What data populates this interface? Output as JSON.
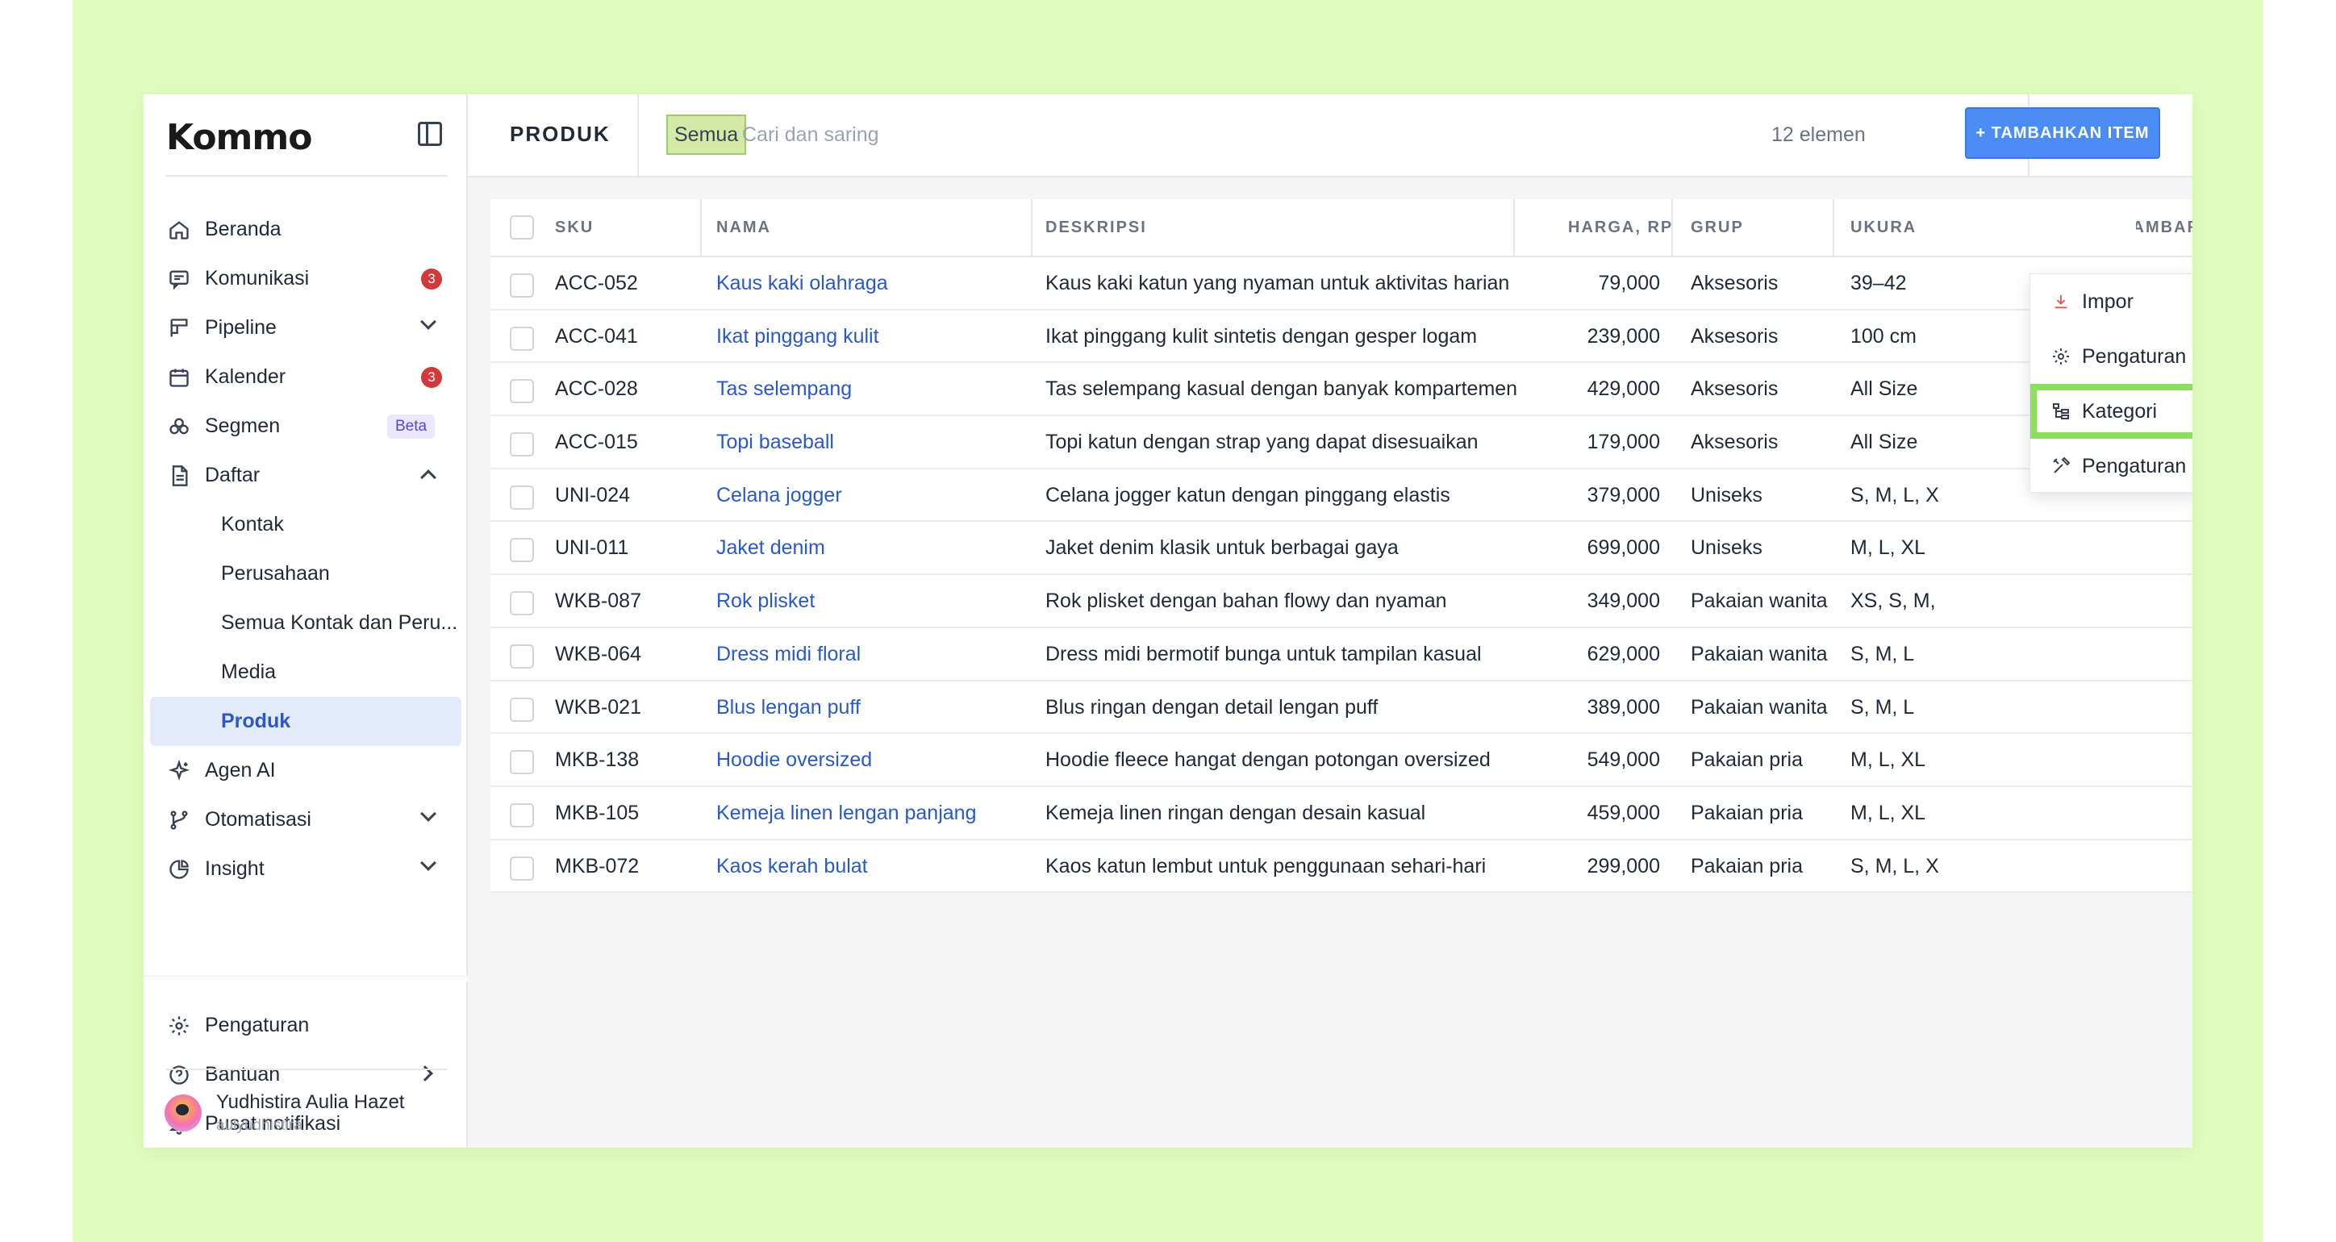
{
  "app": {
    "logo": "Kommo"
  },
  "sidebar": {
    "items": [
      {
        "label": "Beranda",
        "icon": "home-icon"
      },
      {
        "label": "Komunikasi",
        "icon": "chat-icon",
        "badge": "3"
      },
      {
        "label": "Pipeline",
        "icon": "pipeline-icon"
      },
      {
        "label": "Kalender",
        "icon": "calendar-icon",
        "badge": "3"
      },
      {
        "label": "Segmen",
        "icon": "segment-icon",
        "tag": "Beta"
      },
      {
        "label": "Daftar",
        "icon": "list-icon"
      },
      {
        "label": "Kontak"
      },
      {
        "label": "Perusahaan"
      },
      {
        "label": "Semua Kontak dan Peru..."
      },
      {
        "label": "Media"
      },
      {
        "label": "Produk"
      },
      {
        "label": "Agen AI",
        "icon": "sparkle-icon"
      },
      {
        "label": "Otomatisasi",
        "icon": "automation-icon"
      },
      {
        "label": "Insight",
        "icon": "chart-pie-icon"
      }
    ],
    "bottom": [
      {
        "label": "Pengaturan",
        "icon": "gear-icon"
      },
      {
        "label": "Bantuan",
        "icon": "help-icon"
      },
      {
        "label": "Pusat notifikasi",
        "icon": "bell-icon"
      }
    ],
    "user": {
      "name": "Yudhistira Aulia Hazet",
      "login": "aulyudhistira"
    }
  },
  "header": {
    "title": "PRODUK",
    "filter_chip": "Semua",
    "search_placeholder": "Cari dan saring",
    "count": "12 elemen",
    "more": "···",
    "add_button": "+ TAMBAHKAN ITEM"
  },
  "table": {
    "columns": [
      "SKU",
      "NAMA",
      "DESKRIPSI",
      "HARGA, RP",
      "GRUP",
      "UKURA",
      "GAMBAR"
    ],
    "rows": [
      {
        "sku": "ACC-052",
        "nama": "Kaus kaki olahraga",
        "desk": "Kaus kaki katun yang nyaman untuk aktivitas harian",
        "harga": "79,000",
        "grup": "Aksesoris",
        "ukuran": "39–42"
      },
      {
        "sku": "ACC-041",
        "nama": "Ikat pinggang kulit",
        "desk": "Ikat pinggang kulit sintetis dengan gesper logam",
        "harga": "239,000",
        "grup": "Aksesoris",
        "ukuran": "100 cm"
      },
      {
        "sku": "ACC-028",
        "nama": "Tas selempang",
        "desk": "Tas selempang kasual dengan banyak kompartemen",
        "harga": "429,000",
        "grup": "Aksesoris",
        "ukuran": "All Size"
      },
      {
        "sku": "ACC-015",
        "nama": "Topi baseball",
        "desk": "Topi katun dengan strap yang dapat disesuaikan",
        "harga": "179,000",
        "grup": "Aksesoris",
        "ukuran": "All Size"
      },
      {
        "sku": "UNI-024",
        "nama": "Celana jogger",
        "desk": "Celana jogger katun dengan pinggang elastis",
        "harga": "379,000",
        "grup": "Uniseks",
        "ukuran": "S, M, L, XL"
      },
      {
        "sku": "UNI-011",
        "nama": "Jaket denim",
        "desk": "Jaket denim klasik untuk berbagai gaya",
        "harga": "699,000",
        "grup": "Uniseks",
        "ukuran": "M, L, XL"
      },
      {
        "sku": "WKB-087",
        "nama": "Rok plisket",
        "desk": "Rok plisket dengan bahan flowy dan nyaman",
        "harga": "349,000",
        "grup": "Pakaian wanita",
        "ukuran": "XS, S, M, L"
      },
      {
        "sku": "WKB-064",
        "nama": "Dress midi floral",
        "desk": "Dress midi bermotif bunga untuk tampilan kasual",
        "harga": "629,000",
        "grup": "Pakaian wanita",
        "ukuran": "S, M, L"
      },
      {
        "sku": "WKB-021",
        "nama": "Blus lengan puff",
        "desk": "Blus ringan dengan detail lengan puff",
        "harga": "389,000",
        "grup": "Pakaian wanita",
        "ukuran": "S, M, L"
      },
      {
        "sku": "MKB-138",
        "nama": "Hoodie oversized",
        "desk": "Hoodie fleece hangat dengan potongan oversized",
        "harga": "549,000",
        "grup": "Pakaian pria",
        "ukuran": "M, L, XL"
      },
      {
        "sku": "MKB-105",
        "nama": "Kemeja linen lengan panjang",
        "desk": "Kemeja linen ringan dengan desain kasual",
        "harga": "459,000",
        "grup": "Pakaian pria",
        "ukuran": "M, L, XL"
      },
      {
        "sku": "MKB-072",
        "nama": "Kaos kerah bulat",
        "desk": "Kaos katun lembut untuk penggunaan sehari-hari",
        "harga": "299,000",
        "grup": "Pakaian pria",
        "ukuran": "S, M, L, XL"
      }
    ]
  },
  "dropdown": {
    "items": [
      {
        "label": "Impor",
        "icon": "download-icon"
      },
      {
        "label": "Pengaturan entitas",
        "icon": "gear-icon"
      },
      {
        "label": "Kategori",
        "icon": "category-tree-icon"
      },
      {
        "label": "Pengaturan daftar",
        "icon": "tools-icon"
      }
    ]
  },
  "colors": {
    "accent": "#4c8cf5",
    "link": "#2b59c3",
    "badge": "#d1393b",
    "highlight": "#8de05e",
    "frame": "#e1fcbc"
  }
}
